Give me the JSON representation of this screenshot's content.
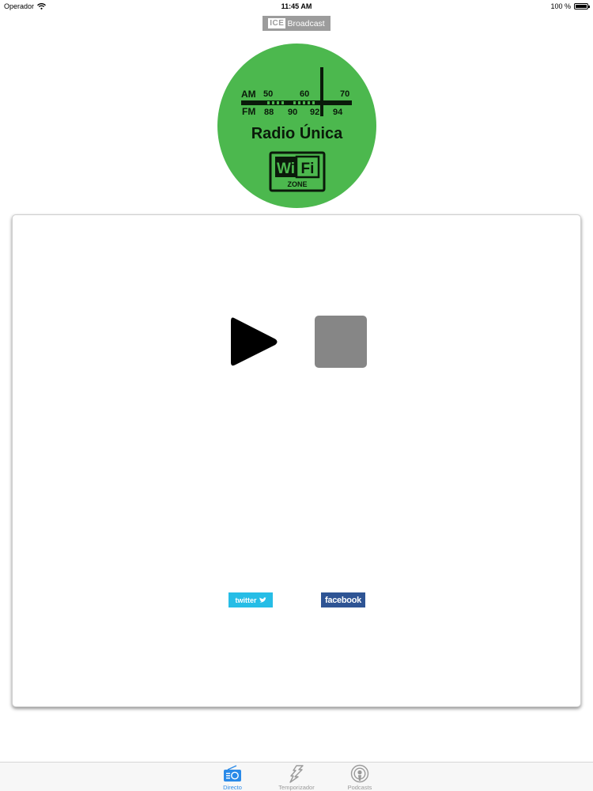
{
  "status_bar": {
    "carrier": "Operador",
    "time": "11:45 AM",
    "battery": "100 %"
  },
  "header": {
    "brand_mark": "ICE",
    "brand_text": "Broadcast"
  },
  "logo": {
    "am_label": "AM",
    "fm_label": "FM",
    "am_ticks": [
      "50",
      "60",
      "70"
    ],
    "fm_ticks": [
      "88",
      "90",
      "92",
      "94"
    ],
    "station_name": "Radio Única",
    "wifi_left": "Wi",
    "wifi_right": "Fi",
    "wifi_zone": "ZONE",
    "colors": {
      "circle": "#4cb84e",
      "ink": "#0a1a0a"
    }
  },
  "player": {
    "play_icon": "play-icon",
    "stop_icon": "stop-icon",
    "twitter_label": "twitter",
    "facebook_label": "facebook",
    "colors": {
      "twitter": "#26bde6",
      "facebook": "#2e5494",
      "stop": "#868686"
    }
  },
  "tabbar": {
    "tabs": [
      {
        "label": "Directo",
        "icon": "radio-icon",
        "active": true
      },
      {
        "label": "Temporizador",
        "icon": "timer-icon",
        "active": false
      },
      {
        "label": "Podcasts",
        "icon": "podcasts-icon",
        "active": false
      }
    ],
    "colors": {
      "active": "#2a8ae8",
      "inactive": "#9a9a9a"
    }
  }
}
